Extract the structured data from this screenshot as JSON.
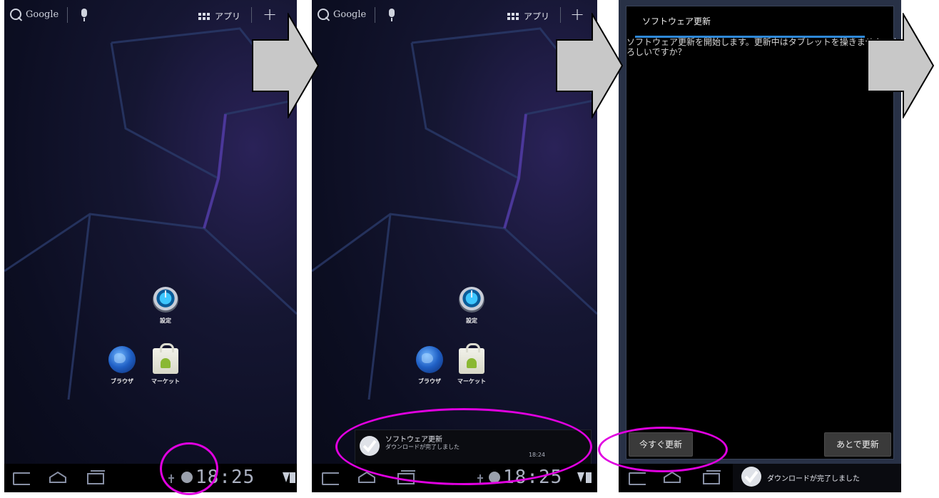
{
  "home": {
    "search_label": "Google",
    "apps_label": "アプリ",
    "add_glyph": "+",
    "icons": [
      {
        "name": "settings",
        "label": "設定"
      },
      {
        "name": "browser",
        "label": "ブラウザ"
      },
      {
        "name": "market",
        "label": "マーケット"
      }
    ]
  },
  "status": {
    "clock": "18:25"
  },
  "notification": {
    "title": "ソフトウェア更新",
    "subtitle": "ダウンロードが完了しました",
    "time": "18:24"
  },
  "dialog": {
    "title": "ソフトウェア更新",
    "message": "ソフトウェア更新を開始します。更新中はタブレットを操きません。よろしいですか？",
    "update_now_label": "今すぐ更新",
    "update_later_label": "あとで更新"
  },
  "tray": {
    "text": "ダウンロードが完了しました"
  },
  "colors": {
    "highlight": "#e000e0",
    "arrow_fill": "#c8c8c8",
    "accent": "#2e88d8"
  }
}
